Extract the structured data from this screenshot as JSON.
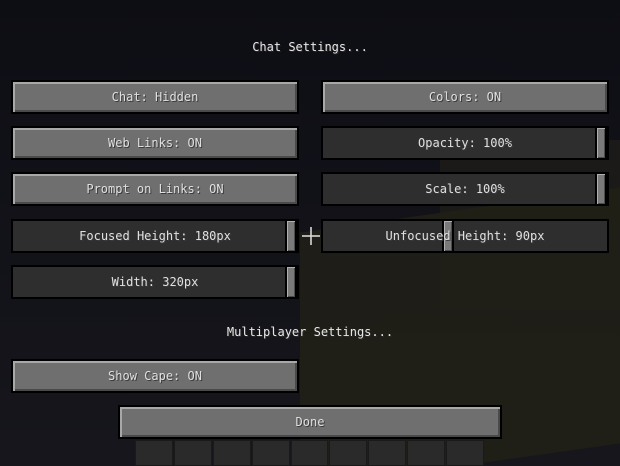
{
  "chat_section": {
    "title": "Chat Settings..."
  },
  "chat_options": {
    "chat_visibility": "Chat: Hidden",
    "colors": "Colors: ON",
    "web_links": "Web Links: ON",
    "opacity": {
      "label": "Opacity: 100%",
      "level": 1.0
    },
    "prompt_on_links": "Prompt on Links: ON",
    "scale": {
      "label": "Scale: 100%",
      "level": 1.0
    },
    "focused_height": {
      "label": "Focused Height: 180px",
      "level": 1.0
    },
    "unfocused_height": {
      "label": "Unfocused Height: 90px",
      "level": 0.44
    },
    "width": {
      "label": "Width: 320px",
      "level": 1.0
    }
  },
  "multiplayer_section": {
    "title": "Multiplayer Settings..."
  },
  "multiplayer_options": {
    "show_cape": "Show Cape: ON"
  },
  "done_label": "Done",
  "hotbar": {
    "slots": 9
  }
}
